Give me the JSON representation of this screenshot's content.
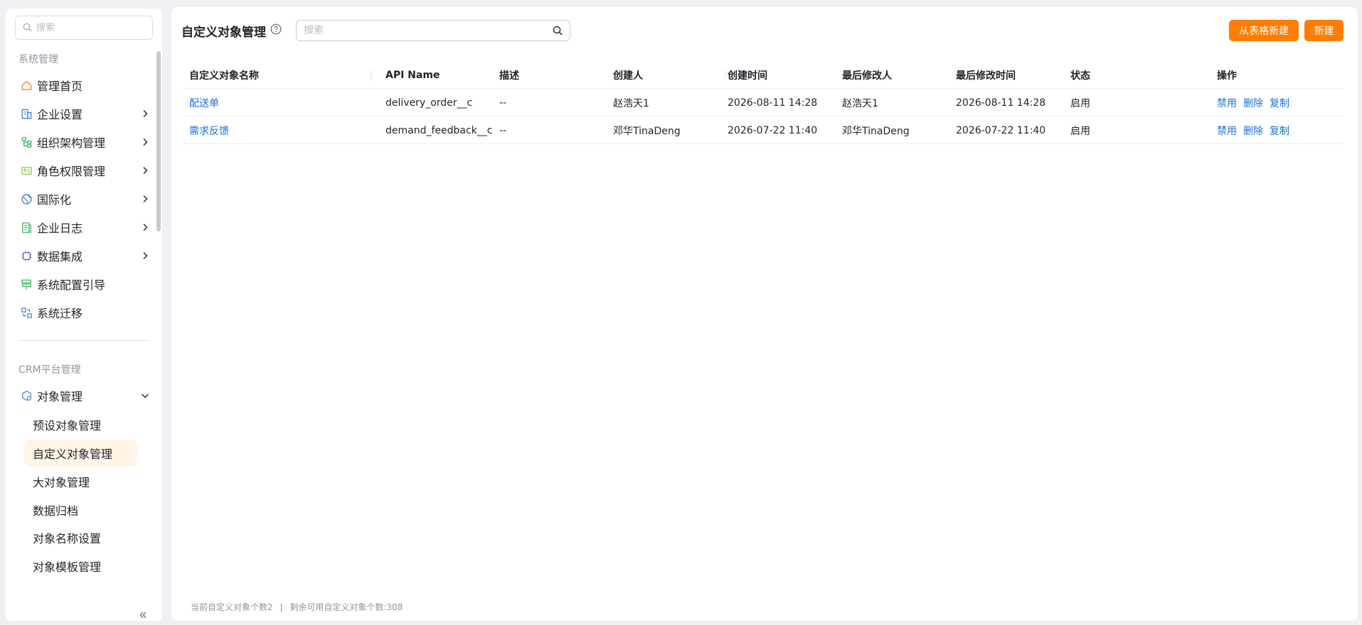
{
  "sidebar": {
    "search_placeholder": "搜索",
    "group_system": "系统管理",
    "system_items": [
      {
        "label": "管理首页",
        "icon": "home-icon",
        "has_children": false
      },
      {
        "label": "企业设置",
        "icon": "building-icon",
        "has_children": true
      },
      {
        "label": "组织架构管理",
        "icon": "org-chart-icon",
        "has_children": true
      },
      {
        "label": "角色权限管理",
        "icon": "id-card-icon",
        "has_children": true
      },
      {
        "label": "国际化",
        "icon": "globe-icon",
        "has_children": true
      },
      {
        "label": "企业日志",
        "icon": "log-icon",
        "has_children": true
      },
      {
        "label": "数据集成",
        "icon": "chip-icon",
        "has_children": true
      },
      {
        "label": "系统配置引导",
        "icon": "signpost-icon",
        "has_children": false
      },
      {
        "label": "系统迁移",
        "icon": "migrate-icon",
        "has_children": false
      }
    ],
    "group_crm": "CRM平台管理",
    "crm_parent": {
      "label": "对象管理",
      "icon": "object-icon",
      "expanded": true
    },
    "crm_children": [
      {
        "label": "预设对象管理",
        "active": false
      },
      {
        "label": "自定义对象管理",
        "active": true
      },
      {
        "label": "大对象管理",
        "active": false
      },
      {
        "label": "数据归档",
        "active": false
      },
      {
        "label": "对象名称设置",
        "active": false
      },
      {
        "label": "对象模板管理",
        "active": false
      }
    ]
  },
  "header": {
    "title": "自定义对象管理",
    "search_placeholder": "搜索",
    "btn_import": "从表格新建",
    "btn_new": "新建"
  },
  "table": {
    "columns": [
      "自定义对象名称",
      "API Name",
      "描述",
      "创建人",
      "创建时间",
      "最后修改人",
      "最后修改时间",
      "状态",
      "操作"
    ],
    "rows": [
      {
        "name": "配送单",
        "api": "delivery_order__c",
        "desc": "--",
        "creator": "赵浩天1",
        "created": "2026-08-11 14:28",
        "modifier": "赵浩天1",
        "modified": "2026-08-11 14:28",
        "status": "启用"
      },
      {
        "name": "需求反馈",
        "api": "demand_feedback__c",
        "desc": "--",
        "creator": "邓华TinaDeng",
        "created": "2026-07-22 11:40",
        "modifier": "邓华TinaDeng",
        "modified": "2026-07-22 11:40",
        "status": "启用"
      }
    ],
    "actions": [
      "禁用",
      "删除",
      "复制"
    ]
  },
  "footer": {
    "current_count": "当前自定义对象个数2",
    "separator": "|",
    "remaining": "剩余可用自定义对象个数:308"
  },
  "colors": {
    "accent": "#ff7d00",
    "link": "#1e6fd9",
    "active_bg": "#fff4e6"
  }
}
